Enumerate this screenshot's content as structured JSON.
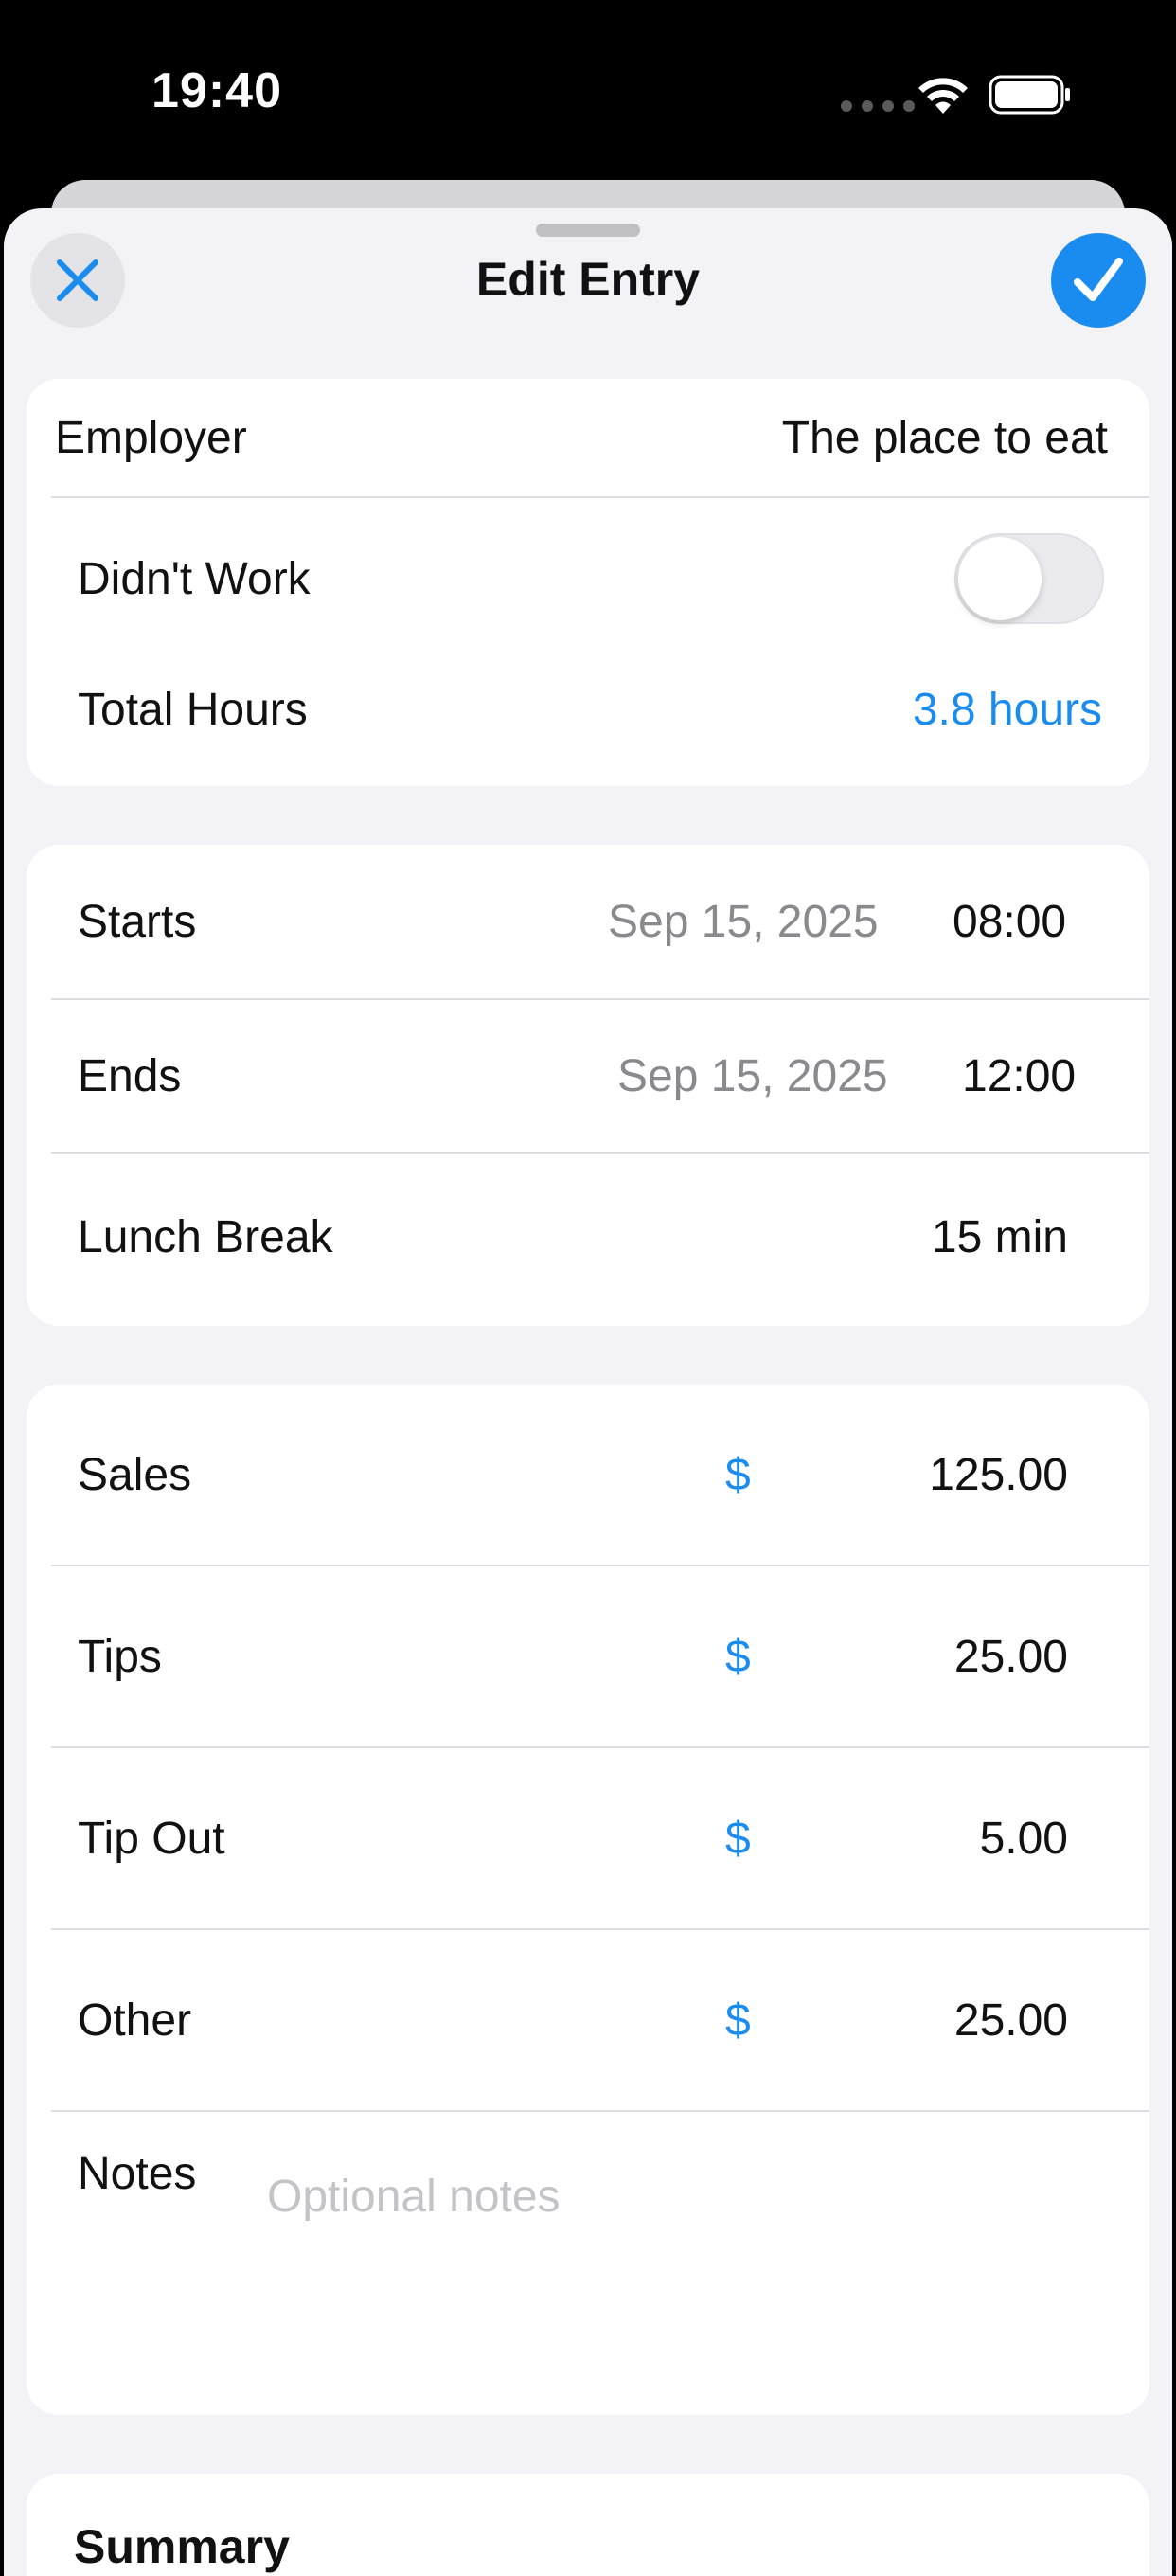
{
  "status_bar": {
    "time": "19:40"
  },
  "sheet": {
    "title": "Edit Entry"
  },
  "employer": {
    "label": "Employer",
    "value": "The place to eat"
  },
  "didnt_work": {
    "label": "Didn't Work",
    "on": false
  },
  "total_hours": {
    "label": "Total Hours",
    "value": "3.8 hours"
  },
  "schedule": {
    "starts": {
      "label": "Starts",
      "date": "Sep 15, 2025",
      "time": "08:00"
    },
    "ends": {
      "label": "Ends",
      "date": "Sep 15, 2025",
      "time": "12:00"
    },
    "lunch": {
      "label": "Lunch Break",
      "value": "15 min"
    }
  },
  "money": {
    "currency_symbol": "$",
    "sales": {
      "label": "Sales",
      "value": "125.00"
    },
    "tips": {
      "label": "Tips",
      "value": "25.00"
    },
    "tip_out": {
      "label": "Tip Out",
      "value": "5.00"
    },
    "other": {
      "label": "Other",
      "value": "25.00"
    }
  },
  "notes": {
    "label": "Notes",
    "placeholder": "Optional notes"
  },
  "summary": {
    "title": "Summary"
  },
  "colors": {
    "accent": "#1a8cf0",
    "background": "#f2f2f7"
  }
}
